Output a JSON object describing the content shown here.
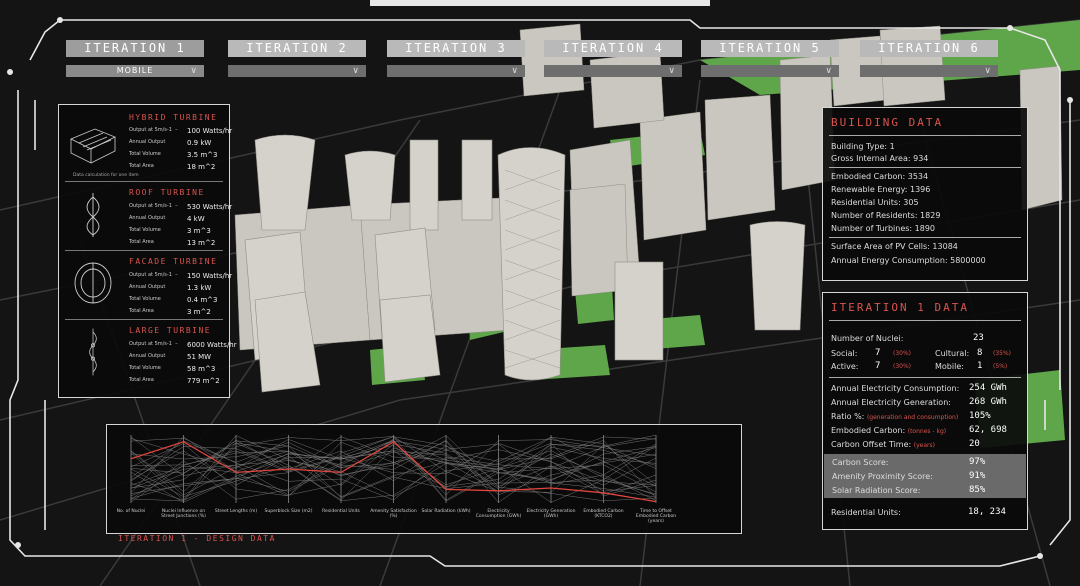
{
  "tabs": [
    {
      "label": "ITERATION 1",
      "dropdown": "MOBILE"
    },
    {
      "label": "ITERATION 2",
      "dropdown": ""
    },
    {
      "label": "ITERATION 3",
      "dropdown": ""
    },
    {
      "label": "ITERATION 4",
      "dropdown": ""
    },
    {
      "label": "ITERATION 5",
      "dropdown": ""
    },
    {
      "label": "ITERATION 6",
      "dropdown": ""
    }
  ],
  "turbines": {
    "hybrid": {
      "title": "HYBRID TURBINE",
      "rows": [
        {
          "label": "Output at 5m/s-1",
          "value": "100 Watts/hr"
        },
        {
          "label": "Annual Output",
          "value": "0.9 kW"
        },
        {
          "label": "Total Volume",
          "value": "3.5 m^3"
        },
        {
          "label": "Total Area",
          "value": "18 m^2"
        }
      ],
      "note": "Data calculation for one item"
    },
    "roof": {
      "title": "ROOF TURBINE",
      "rows": [
        {
          "label": "Output at 5m/s-1",
          "value": "530 Watts/hr"
        },
        {
          "label": "Annual Output",
          "value": "4 kW"
        },
        {
          "label": "Total Volume",
          "value": "3 m^3"
        },
        {
          "label": "Total Area",
          "value": "13 m^2"
        }
      ]
    },
    "facade": {
      "title": "FACADE TURBINE",
      "rows": [
        {
          "label": "Output at 5m/s-1",
          "value": "150 Watts/hr"
        },
        {
          "label": "Annual Output",
          "value": "1.3 kW"
        },
        {
          "label": "Total Volume",
          "value": "0.4 m^3"
        },
        {
          "label": "Total Area",
          "value": "3 m^2"
        }
      ]
    },
    "large": {
      "title": "LARGE TURBINE",
      "rows": [
        {
          "label": "Output at 5m/s-1",
          "value": "6000 Watts/hr"
        },
        {
          "label": "Annual Output",
          "value": "51 MW"
        },
        {
          "label": "Total Volume",
          "value": "58 m^3"
        },
        {
          "label": "Total Area",
          "value": "779 m^2"
        }
      ]
    }
  },
  "building": {
    "title": "BUILDING DATA",
    "type": "Building Type:   1",
    "gia": "Gross Internal Area:   934",
    "embodied": "Embodied Carbon:   3534",
    "renewable": "Renewable Energy:   1396",
    "residential": "Residential Units:   305",
    "residents": "Number of Residents:   1829",
    "turbines": "Number of Turbines:   1890",
    "pv": "Surface Area of PV Cells:   13084",
    "annual": "Annual Energy Consumption:   5800000"
  },
  "iteration": {
    "title": "ITERATION 1 DATA",
    "nuclei_label": "Number of Nuclei:",
    "nuclei": "23",
    "social_label": "Social:",
    "social": "7",
    "social_pct": "(30%)",
    "cultural_label": "Cultural:",
    "cultural": "8",
    "cultural_pct": "(35%)",
    "active_label": "Active:",
    "active": "7",
    "active_pct": "(30%)",
    "mobile_label": "Mobile:",
    "mobile": "1",
    "mobile_pct": "(5%)",
    "consumption_label": "Annual Electricity Consumption:",
    "consumption": "254 GWh",
    "generation_label": "Annual Electricity Generation:",
    "generation": "268 GWh",
    "ratio_label": "Ratio %:",
    "ratio_note": "(generation and consumption)",
    "ratio": "105%",
    "embodied_label": "Embodied Carbon:",
    "embodied_note": "(tonnes - kg)",
    "embodied": "62, 698",
    "offset_label": "Carbon Offset Time:",
    "offset_note": "(years)",
    "offset": "20",
    "carbon_score_label": "Carbon Score:",
    "carbon_score": "97%",
    "amenity_label": "Amenity Proximity Score:",
    "amenity": "91%",
    "solar_label": "Solar Radiation Score:",
    "solar": "85%",
    "units_label": "Residential Units:",
    "units": "18, 234"
  },
  "design": {
    "title": "ITERATION 1 - DESIGN DATA",
    "axes": [
      "No. of Nuclei",
      "Nuclei Influence on Street Junctions (%)",
      "Street Lengths (m)",
      "Superblock Size (m2)",
      "Residential Units",
      "Amenity Satisfaction (%)",
      "Solar Radiation (kWh)",
      "Electricity Consumption (GWh)",
      "Electricity Generation (GWh)",
      "Embodied Carbon (KTCO2)",
      "Time to Offset Embodied Carbon (years)"
    ],
    "accent": "#e0453f"
  }
}
